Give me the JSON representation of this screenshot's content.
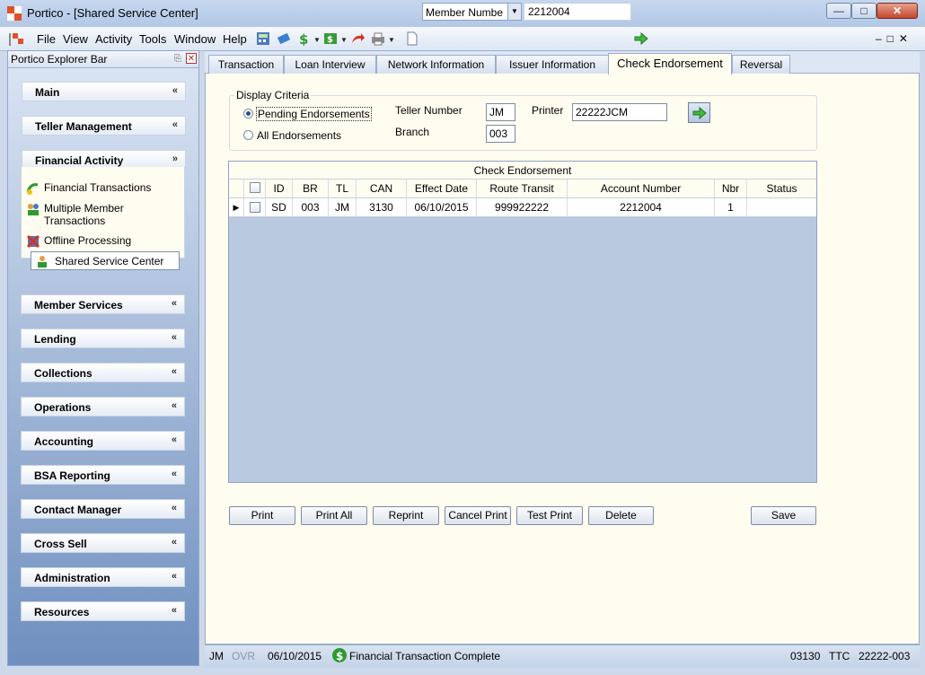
{
  "window": {
    "title": "Portico - [Shared Service Center]"
  },
  "menu": [
    "File",
    "View",
    "Activity",
    "Tools",
    "Window",
    "Help"
  ],
  "toolbar": {
    "member_type": "Member Numbe",
    "member_number": "2212004"
  },
  "explorer": {
    "title": "Portico Explorer Bar",
    "groups_top": [
      "Main",
      "Teller Management"
    ],
    "financial_activity": {
      "label": "Financial Activity",
      "items": [
        "Financial Transactions",
        "Multiple Member",
        "Transactions",
        "Offline Processing",
        "Shared Service Center"
      ]
    },
    "groups_bottom": [
      "Member Services",
      "Lending",
      "Collections",
      "Operations",
      "Accounting",
      "BSA Reporting",
      "Contact Manager",
      "Cross Sell",
      "Administration",
      "Resources"
    ]
  },
  "tabs": [
    "Transaction",
    "Loan Interview",
    "Network Information",
    "Issuer Information",
    "Check Endorsement",
    "Reversal"
  ],
  "criteria": {
    "legend": "Display Criteria",
    "pending_label": "Pending Endorsements",
    "all_label": "All Endorsements",
    "teller_label": "Teller Number",
    "teller_value": "JM",
    "branch_label": "Branch",
    "branch_value": "003",
    "printer_label": "Printer",
    "printer_value": "22222JCM"
  },
  "grid": {
    "caption": "Check Endorsement",
    "columns": [
      "ID",
      "BR",
      "TL",
      "CAN",
      "Effect Date",
      "Route Transit",
      "Account Number",
      "Nbr",
      "Status"
    ],
    "rows": [
      [
        "SD",
        "003",
        "JM",
        "3130",
        "06/10/2015",
        "999922222",
        "2212004",
        "1",
        ""
      ]
    ]
  },
  "buttons": [
    "Print",
    "Print All",
    "Reprint",
    "Cancel Print",
    "Test Print",
    "Delete",
    "Save"
  ],
  "status": {
    "user": "JM",
    "ovr": "OVR",
    "date": "06/10/2015",
    "message": "Financial Transaction Complete",
    "branch": "03130",
    "mode": "TTC",
    "station": "22222-003"
  },
  "colors": {
    "accent": "#2b4f86",
    "panel_bg": "#fffdf0",
    "grid_bg": "#b9c9df"
  }
}
